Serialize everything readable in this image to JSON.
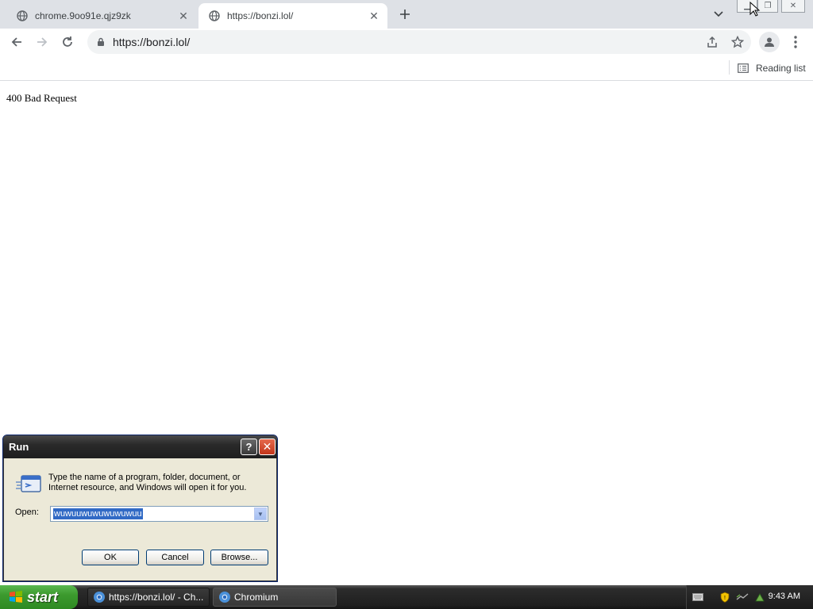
{
  "browser": {
    "tabs": [
      {
        "title": "chrome.9oo91e.qjz9zk",
        "active": false
      },
      {
        "title": "https://bonzi.lol/",
        "active": true
      }
    ],
    "url": "https://bonzi.lol/",
    "reading_list_label": "Reading list"
  },
  "page": {
    "message": "400 Bad Request"
  },
  "run_dialog": {
    "title": "Run",
    "help_label": "?",
    "description": "Type the name of a program, folder, document, or Internet resource, and Windows will open it for you.",
    "open_label": "Open:",
    "open_value": "wuwuuwuwuwuwuwuu",
    "ok_label": "OK",
    "cancel_label": "Cancel",
    "browse_label": "Browse..."
  },
  "taskbar": {
    "start_label": "start",
    "tasks": [
      {
        "label": "https://bonzi.lol/ - Ch..."
      },
      {
        "label": "Chromium"
      }
    ],
    "clock": "9:43 AM"
  },
  "colors": {
    "tabstrip_bg": "#dee1e6",
    "xp_start_green": "#3c9a2e",
    "xp_close_red": "#c2351a",
    "selection_blue": "#316ac5"
  }
}
